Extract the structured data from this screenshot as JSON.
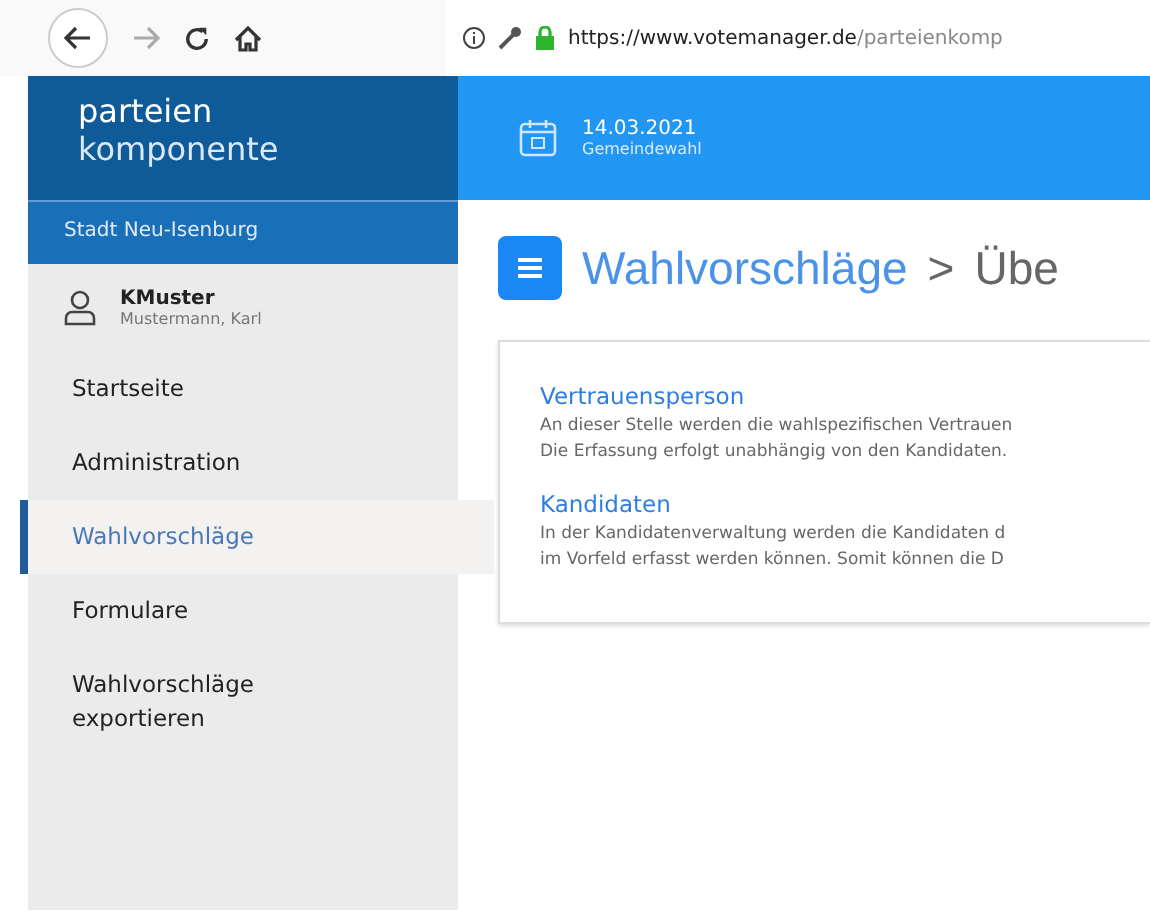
{
  "browser": {
    "url_host": "https://www.votemanager.de",
    "url_path": "/parteienkomp"
  },
  "sidebar": {
    "brand_line_1": "parteien",
    "brand_line_2": "komponente",
    "organisation": "Stadt Neu-Isenburg",
    "user": {
      "login": "KMuster",
      "name": "Mustermann, Karl"
    },
    "items": [
      {
        "label": "Startseite",
        "selected": false
      },
      {
        "label": "Administration",
        "selected": false
      },
      {
        "label": "Wahlvorschläge",
        "selected": true
      },
      {
        "label": "Formulare",
        "selected": false
      },
      {
        "label": "Wahlvorschläge exportieren",
        "selected": false
      }
    ]
  },
  "header": {
    "date": "14.03.2021",
    "election": "Gemeindewahl"
  },
  "page": {
    "title_link": "Wahlvorschläge",
    "separator": ">",
    "title_rest": "Übe"
  },
  "sections": [
    {
      "title": "Vertrauensperson",
      "lines": [
        "An dieser Stelle werden die wahlspezifischen Vertrauen",
        "Die Erfassung erfolgt unabhängig von den Kandidaten."
      ]
    },
    {
      "title": "Kandidaten",
      "lines": [
        "In der Kandidatenverwaltung werden die Kandidaten d",
        "im Vorfeld erfasst werden können. Somit können die D"
      ]
    }
  ]
}
